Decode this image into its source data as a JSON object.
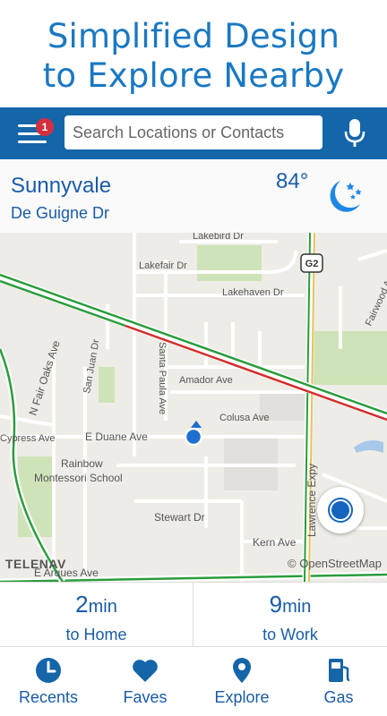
{
  "promo": {
    "line1": "Simplified Design",
    "line2": "to Explore Nearby"
  },
  "topbar": {
    "notification_count": "1",
    "search_placeholder": "Search Locations or Contacts"
  },
  "weather": {
    "city": "Sunnyvale",
    "street": "De Guigne Dr",
    "temperature": "84°",
    "condition_icon": "moon-stars-icon"
  },
  "map": {
    "labels": {
      "lakebird": "Lakebird Dr",
      "lakefair": "Lakefair Dr",
      "lakehaven": "Lakehaven Dr",
      "fairwood": "Fairwood Ave",
      "fair_oaks": "N Fair Oaks Ave",
      "san_juan": "San Juan Dr",
      "santa_paula": "Santa Paula Ave",
      "amador": "Amador Ave",
      "colusa": "Colusa Ave",
      "cypress": "Cypress Ave",
      "duane": "E Duane Ave",
      "school_line1": "Rainbow",
      "school_line2": "Montessori School",
      "stewart": "Stewart Dr",
      "lawrence": "Lawrence Expy",
      "kern": "Kern Ave",
      "arques": "E Arques Ave",
      "shield": "G2"
    },
    "brand": "TELENAV",
    "attribution": "© OpenStreetMap"
  },
  "etas": [
    {
      "value": "2",
      "unit": "min",
      "destination": "to Home"
    },
    {
      "value": "9",
      "unit": "min",
      "destination": "to Work"
    }
  ],
  "nav": [
    {
      "label": "Recents",
      "icon": "clock-icon"
    },
    {
      "label": "Faves",
      "icon": "heart-icon"
    },
    {
      "label": "Explore",
      "icon": "map-pin-icon"
    },
    {
      "label": "Gas",
      "icon": "gas-pump-icon"
    }
  ],
  "colors": {
    "brand_blue": "#1565a9",
    "text_blue": "#1a5ca8",
    "badge_red": "#d32f3c"
  }
}
